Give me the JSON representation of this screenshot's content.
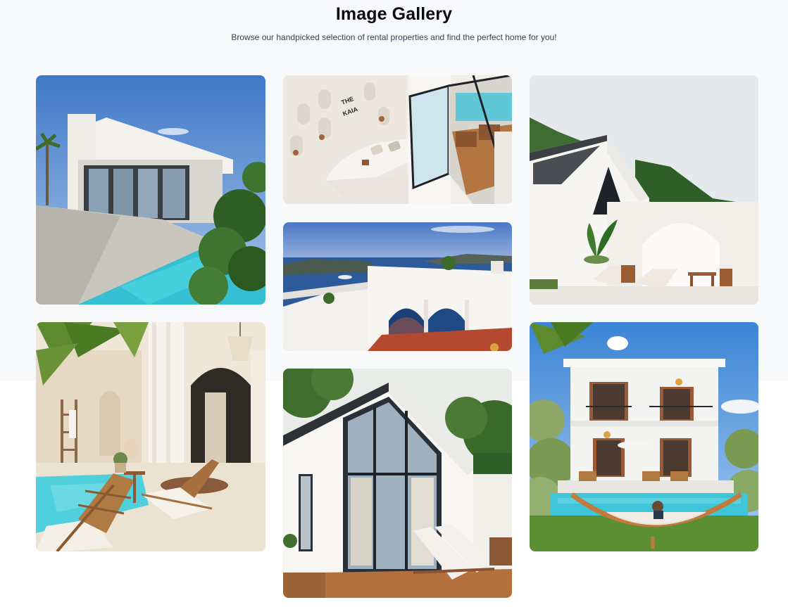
{
  "header": {
    "title": "Image Gallery",
    "subtitle": "Browse our handpicked selection of rental properties and find the perfect home for you!"
  },
  "gallery": {
    "images": [
      {
        "id": "modern-villa-pool",
        "alt": "Modern white villa with pool"
      },
      {
        "id": "kaia-interior",
        "alt": "The Kaia interior with curved sofa"
      },
      {
        "id": "gable-house-arch",
        "alt": "White gable house with arch terrace"
      },
      {
        "id": "santorini-arches",
        "alt": "Whitewashed arches over the sea"
      },
      {
        "id": "boho-pool-courtyard",
        "alt": "Boho pool courtyard with loungers"
      },
      {
        "id": "glass-gable-house",
        "alt": "White gable house with glass facade"
      },
      {
        "id": "two-story-hammock",
        "alt": "Two-story villa with hammock and pool"
      }
    ],
    "kaia_sign": [
      "THE",
      "KAIA"
    ]
  },
  "colors": {
    "background": "#f8f9fb",
    "sky": "#5b8fd0",
    "pool": "#35c1d3",
    "white_wall": "#f4f2ee",
    "wood": "#a8683a",
    "green": "#3f6e2f"
  }
}
